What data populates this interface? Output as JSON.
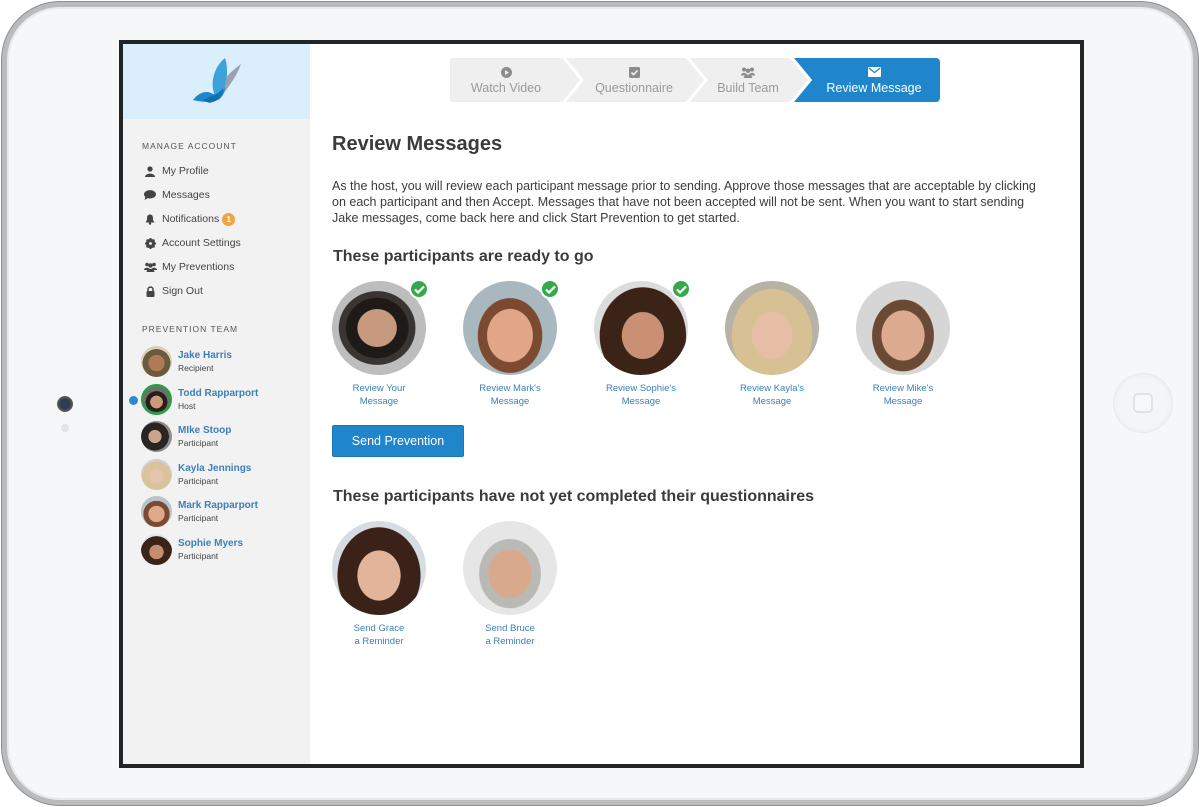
{
  "sidebar": {
    "manage_account_label": "MANAGE ACCOUNT",
    "menu": [
      {
        "label": "My Profile",
        "icon": "user-icon"
      },
      {
        "label": "Messages",
        "icon": "chat-bubble-icon"
      },
      {
        "label": "Notifications",
        "icon": "bell-icon",
        "badge": "1"
      },
      {
        "label": "Account Settings",
        "icon": "gear-icon"
      },
      {
        "label": "My Preventions",
        "icon": "group-icon"
      },
      {
        "label": "Sign Out",
        "icon": "lock-icon"
      }
    ],
    "team_label": "PREVENTION TEAM",
    "team": [
      {
        "name": "Jake Harris",
        "role": "Recipient"
      },
      {
        "name": "Todd Rapparport",
        "role": "Host",
        "active": true
      },
      {
        "name": "MIke Stoop",
        "role": "Participant"
      },
      {
        "name": "Kayla Jennings",
        "role": "Participant"
      },
      {
        "name": "Mark Rapparport",
        "role": "Participant"
      },
      {
        "name": "Sophie Myers",
        "role": "Participant"
      }
    ]
  },
  "steps": [
    {
      "label": "Watch Video",
      "icon": "play-icon"
    },
    {
      "label": "Questionnaire",
      "icon": "checkbox-icon"
    },
    {
      "label": "Build Team",
      "icon": "group-icon"
    },
    {
      "label": "Review Message",
      "icon": "envelope-icon",
      "active": true
    }
  ],
  "main": {
    "title": "Review Messages",
    "intro": "As the host, you will review each participant message prior to sending. Approve those messages that are acceptable by clicking on each participant and then Accept. Messages that have not been accepted will not be sent. When you want to start sending Jake messages, come back here and click Start Prevention to get started.",
    "ready_title": "These participants are ready to go",
    "ready": [
      {
        "line1": "Review Your",
        "line2": "Message",
        "approved": true
      },
      {
        "line1": "Review Mark's",
        "line2": "Message",
        "approved": true
      },
      {
        "line1": "Review Sophie's",
        "line2": "Message",
        "approved": true
      },
      {
        "line1": "Review Kayla's",
        "line2": "Message",
        "approved": false
      },
      {
        "line1": "Review Mike's",
        "line2": "Message",
        "approved": false
      }
    ],
    "send_button": "Send Prevention",
    "pending_title": "These participants have not yet completed their questionnaires",
    "pending": [
      {
        "line1": "Send Grace",
        "line2": "a Reminder"
      },
      {
        "line1": "Send Bruce",
        "line2": "a Reminder"
      }
    ]
  },
  "colors": {
    "accent": "#1f86cc",
    "link": "#3d7fb8",
    "approved": "#37a94b",
    "badge": "#f0a542"
  }
}
